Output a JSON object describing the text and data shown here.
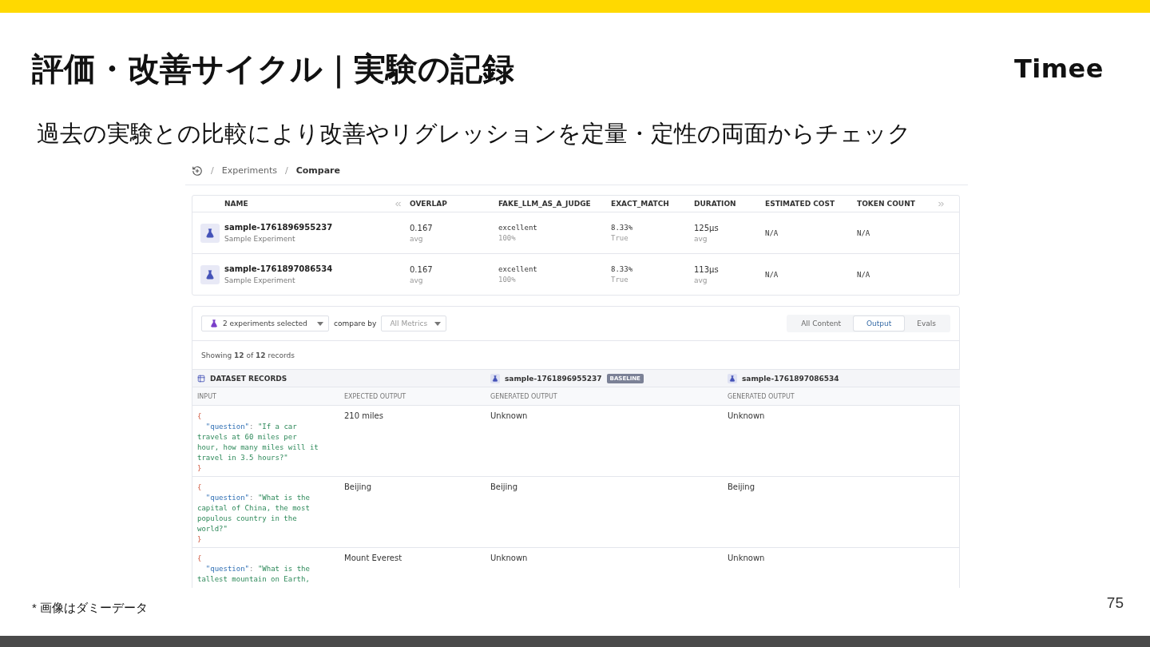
{
  "slide": {
    "title": "評価・改善サイクル｜実験の記録",
    "logo": "Timee",
    "subtitle": "過去の実験との比較により改善やリグレッションを定量・定性の両面からチェック",
    "footnote": "* 画像はダミーデータ",
    "page_number": "75"
  },
  "breadcrumb": [
    {
      "separator": "/",
      "label": "Experiments"
    },
    {
      "separator": "/",
      "label": "Compare"
    }
  ],
  "summary": {
    "columns": [
      "NAME",
      "OVERLAP",
      "FAKE_LLM_AS_A_JUDGE",
      "EXACT_MATCH",
      "DURATION",
      "ESTIMATED COST",
      "TOKEN COUNT"
    ],
    "rows": [
      {
        "cells": [
          {
            "kind": "name",
            "value": "sample-1761896955237",
            "sub": "Sample Experiment"
          },
          {
            "kind": "text",
            "value": "0.167",
            "sub": "avg"
          },
          {
            "kind": "code",
            "value": "excellent",
            "sub": "100%"
          },
          {
            "kind": "code",
            "value": "8.33%",
            "sub": "True"
          },
          {
            "kind": "text",
            "value": "125μs",
            "sub": "avg"
          },
          {
            "kind": "code",
            "value": "N/A"
          },
          {
            "kind": "code",
            "value": "N/A"
          }
        ]
      },
      {
        "cells": [
          {
            "kind": "name",
            "value": "sample-1761897086534",
            "sub": "Sample Experiment"
          },
          {
            "kind": "text",
            "value": "0.167",
            "sub": "avg"
          },
          {
            "kind": "code",
            "value": "excellent",
            "sub": "100%"
          },
          {
            "kind": "code",
            "value": "8.33%",
            "sub": "True"
          },
          {
            "kind": "text",
            "value": "113μs",
            "sub": "avg"
          },
          {
            "kind": "code",
            "value": "N/A"
          },
          {
            "kind": "code",
            "value": "N/A"
          }
        ]
      }
    ]
  },
  "toolbar": {
    "experiments_select": "2 experiments selected",
    "compare_label": "compare by",
    "metrics_select": {
      "placeholder": "All Metrics"
    },
    "tabs": [
      {
        "label": "All Content",
        "selected": false
      },
      {
        "label": "Output",
        "selected": true
      },
      {
        "label": "Evals",
        "selected": false
      }
    ]
  },
  "showing": "Showing **12** of **12** records",
  "records": {
    "dataset_header": "DATASET RECORDS",
    "experiments": [
      {
        "name": "sample-1761896955237",
        "badge": "BASELINE"
      },
      {
        "name": "sample-1761897086534"
      }
    ],
    "columns": [
      "INPUT",
      "EXPECTED OUTPUT",
      "GENERATED OUTPUT",
      "GENERATED OUTPUT"
    ],
    "rows": [
      {
        "input": {
          "open": "{",
          "key": "\"question\"",
          "sep": ":",
          "value": "\"If a car travels at 60 miles per hour, how many miles will it travel in 3.5 hours?\"",
          "close": "}"
        },
        "expected": "210 miles",
        "outputs": [
          "Unknown",
          "Unknown"
        ]
      },
      {
        "input": {
          "open": "{",
          "key": "\"question\"",
          "sep": ":",
          "value": "\"What is the capital of China, the most populous country in the world?\"",
          "close": "}"
        },
        "expected": "Beijing",
        "outputs": [
          "Beijing",
          "Beijing"
        ]
      },
      {
        "input": {
          "open": "{",
          "key": "\"question\"",
          "sep": ":",
          "value": "\"What is the tallest mountain on Earth,"
        },
        "expected": "Mount Everest",
        "outputs": [
          "Unknown",
          "Unknown"
        ]
      }
    ]
  }
}
